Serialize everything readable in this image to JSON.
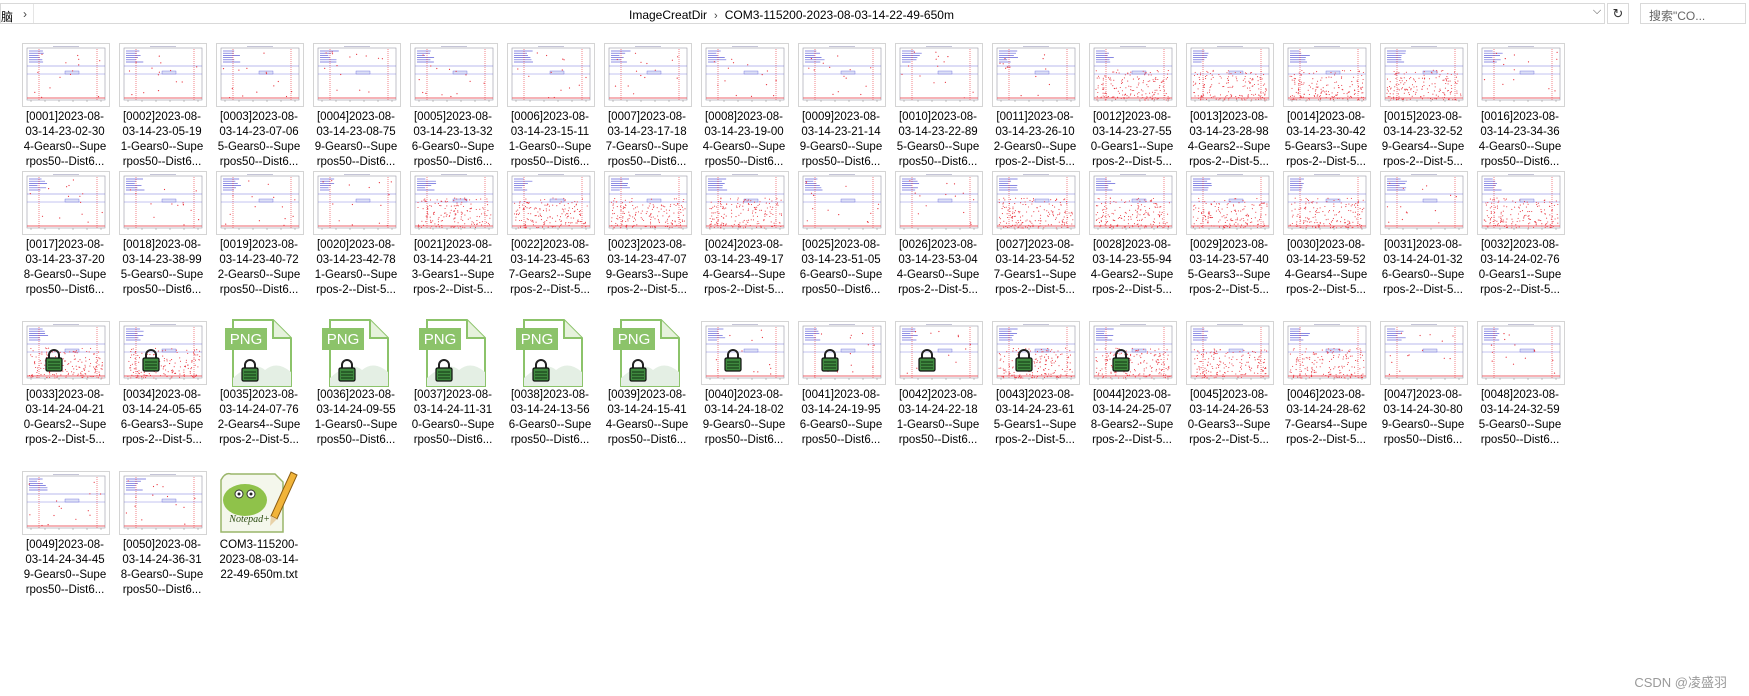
{
  "address_bar": {
    "left_crumb": "脑",
    "path": [
      "ImageCreatDir",
      "COM3-115200-2023-08-03-14-22-49-650m"
    ],
    "dropdown_icon": "chevron-down-icon",
    "refresh_icon": "refresh-icon",
    "search_placeholder": "搜索\"CO..."
  },
  "files": [
    {
      "lines": [
        "[0001]2023-08-",
        "03-14-23-02-30",
        "4-Gears0--Supe",
        "rpos50--Dist6..."
      ],
      "thumb": "flat",
      "locked": false
    },
    {
      "lines": [
        "[0002]2023-08-",
        "03-14-23-05-19",
        "1-Gears0--Supe",
        "rpos50--Dist6..."
      ],
      "thumb": "flat",
      "locked": false
    },
    {
      "lines": [
        "[0003]2023-08-",
        "03-14-23-07-06",
        "5-Gears0--Supe",
        "rpos50--Dist6..."
      ],
      "thumb": "flat",
      "locked": false
    },
    {
      "lines": [
        "[0004]2023-08-",
        "03-14-23-08-75",
        "9-Gears0--Supe",
        "rpos50--Dist6..."
      ],
      "thumb": "flat",
      "locked": false
    },
    {
      "lines": [
        "[0005]2023-08-",
        "03-14-23-13-32",
        "6-Gears0--Supe",
        "rpos50--Dist6..."
      ],
      "thumb": "flat",
      "locked": false
    },
    {
      "lines": [
        "[0006]2023-08-",
        "03-14-23-15-11",
        "1-Gears0--Supe",
        "rpos50--Dist6..."
      ],
      "thumb": "flat",
      "locked": false
    },
    {
      "lines": [
        "[0007]2023-08-",
        "03-14-23-17-18",
        "7-Gears0--Supe",
        "rpos50--Dist6..."
      ],
      "thumb": "flat",
      "locked": false
    },
    {
      "lines": [
        "[0008]2023-08-",
        "03-14-23-19-00",
        "4-Gears0--Supe",
        "rpos50--Dist6..."
      ],
      "thumb": "flat",
      "locked": false
    },
    {
      "lines": [
        "[0009]2023-08-",
        "03-14-23-21-14",
        "9-Gears0--Supe",
        "rpos50--Dist6..."
      ],
      "thumb": "flat",
      "locked": false
    },
    {
      "lines": [
        "[0010]2023-08-",
        "03-14-23-22-89",
        "5-Gears0--Supe",
        "rpos50--Dist6..."
      ],
      "thumb": "flat",
      "locked": false
    },
    {
      "lines": [
        "[0011]2023-08-",
        "03-14-23-26-10",
        "2-Gears0--Supe",
        "rpos-2--Dist-5..."
      ],
      "thumb": "flat",
      "locked": false
    },
    {
      "lines": [
        "[0012]2023-08-",
        "03-14-23-27-55",
        "0-Gears1--Supe",
        "rpos-2--Dist-5..."
      ],
      "thumb": "dense",
      "locked": false
    },
    {
      "lines": [
        "[0013]2023-08-",
        "03-14-23-28-98",
        "4-Gears2--Supe",
        "rpos-2--Dist-5..."
      ],
      "thumb": "dense",
      "locked": false
    },
    {
      "lines": [
        "[0014]2023-08-",
        "03-14-23-30-42",
        "5-Gears3--Supe",
        "rpos-2--Dist-5..."
      ],
      "thumb": "dense",
      "locked": false
    },
    {
      "lines": [
        "[0015]2023-08-",
        "03-14-23-32-52",
        "9-Gears4--Supe",
        "rpos-2--Dist-5..."
      ],
      "thumb": "dense",
      "locked": false
    },
    {
      "lines": [
        "[0016]2023-08-",
        "03-14-23-34-36",
        "4-Gears0--Supe",
        "rpos50--Dist6..."
      ],
      "thumb": "flat",
      "locked": false
    },
    {
      "lines": [
        "[0017]2023-08-",
        "03-14-23-37-20",
        "8-Gears0--Supe",
        "rpos50--Dist6..."
      ],
      "thumb": "flat",
      "locked": false
    },
    {
      "lines": [
        "[0018]2023-08-",
        "03-14-23-38-99",
        "5-Gears0--Supe",
        "rpos50--Dist6..."
      ],
      "thumb": "flat",
      "locked": false
    },
    {
      "lines": [
        "[0019]2023-08-",
        "03-14-23-40-72",
        "2-Gears0--Supe",
        "rpos50--Dist6..."
      ],
      "thumb": "flat",
      "locked": false
    },
    {
      "lines": [
        "[0020]2023-08-",
        "03-14-23-42-78",
        "1-Gears0--Supe",
        "rpos-2--Dist-5..."
      ],
      "thumb": "flat",
      "locked": false
    },
    {
      "lines": [
        "[0021]2023-08-",
        "03-14-23-44-21",
        "3-Gears1--Supe",
        "rpos-2--Dist-5..."
      ],
      "thumb": "dense",
      "locked": false
    },
    {
      "lines": [
        "[0022]2023-08-",
        "03-14-23-45-63",
        "7-Gears2--Supe",
        "rpos-2--Dist-5..."
      ],
      "thumb": "dense",
      "locked": false
    },
    {
      "lines": [
        "[0023]2023-08-",
        "03-14-23-47-07",
        "9-Gears3--Supe",
        "rpos-2--Dist-5..."
      ],
      "thumb": "dense",
      "locked": false
    },
    {
      "lines": [
        "[0024]2023-08-",
        "03-14-23-49-17",
        "4-Gears4--Supe",
        "rpos-2--Dist-5..."
      ],
      "thumb": "dense",
      "locked": false
    },
    {
      "lines": [
        "[0025]2023-08-",
        "03-14-23-51-05",
        "6-Gears0--Supe",
        "rpos50--Dist6..."
      ],
      "thumb": "flat",
      "locked": false
    },
    {
      "lines": [
        "[0026]2023-08-",
        "03-14-23-53-04",
        "4-Gears0--Supe",
        "rpos-2--Dist-5..."
      ],
      "thumb": "flat",
      "locked": false
    },
    {
      "lines": [
        "[0027]2023-08-",
        "03-14-23-54-52",
        "7-Gears1--Supe",
        "rpos-2--Dist-5..."
      ],
      "thumb": "dense",
      "locked": false
    },
    {
      "lines": [
        "[0028]2023-08-",
        "03-14-23-55-94",
        "4-Gears2--Supe",
        "rpos-2--Dist-5..."
      ],
      "thumb": "dense",
      "locked": false
    },
    {
      "lines": [
        "[0029]2023-08-",
        "03-14-23-57-40",
        "5-Gears3--Supe",
        "rpos-2--Dist-5..."
      ],
      "thumb": "dense",
      "locked": false
    },
    {
      "lines": [
        "[0030]2023-08-",
        "03-14-23-59-52",
        "4-Gears4--Supe",
        "rpos-2--Dist-5..."
      ],
      "thumb": "dense",
      "locked": false
    },
    {
      "lines": [
        "[0031]2023-08-",
        "03-14-24-01-32",
        "6-Gears0--Supe",
        "rpos-2--Dist-5..."
      ],
      "thumb": "flat",
      "locked": false
    },
    {
      "lines": [
        "[0032]2023-08-",
        "03-14-24-02-76",
        "0-Gears1--Supe",
        "rpos-2--Dist-5..."
      ],
      "thumb": "dense",
      "locked": false
    },
    {
      "lines": [
        "[0033]2023-08-",
        "03-14-24-04-21",
        "0-Gears2--Supe",
        "rpos-2--Dist-5..."
      ],
      "thumb": "dense",
      "locked": true
    },
    {
      "lines": [
        "[0034]2023-08-",
        "03-14-24-05-65",
        "6-Gears3--Supe",
        "rpos-2--Dist-5..."
      ],
      "thumb": "dense",
      "locked": true
    },
    {
      "lines": [
        "[0035]2023-08-",
        "03-14-24-07-76",
        "2-Gears4--Supe",
        "rpos-2--Dist-5..."
      ],
      "thumb": "png",
      "locked": true
    },
    {
      "lines": [
        "[0036]2023-08-",
        "03-14-24-09-55",
        "1-Gears0--Supe",
        "rpos50--Dist6..."
      ],
      "thumb": "png",
      "locked": true
    },
    {
      "lines": [
        "[0037]2023-08-",
        "03-14-24-11-31",
        "0-Gears0--Supe",
        "rpos50--Dist6..."
      ],
      "thumb": "png",
      "locked": true
    },
    {
      "lines": [
        "[0038]2023-08-",
        "03-14-24-13-56",
        "6-Gears0--Supe",
        "rpos50--Dist6..."
      ],
      "thumb": "png",
      "locked": true
    },
    {
      "lines": [
        "[0039]2023-08-",
        "03-14-24-15-41",
        "4-Gears0--Supe",
        "rpos50--Dist6..."
      ],
      "thumb": "png",
      "locked": true
    },
    {
      "lines": [
        "[0040]2023-08-",
        "03-14-24-18-02",
        "9-Gears0--Supe",
        "rpos50--Dist6..."
      ],
      "thumb": "flat",
      "locked": true
    },
    {
      "lines": [
        "[0041]2023-08-",
        "03-14-24-19-95",
        "6-Gears0--Supe",
        "rpos50--Dist6..."
      ],
      "thumb": "flat",
      "locked": true
    },
    {
      "lines": [
        "[0042]2023-08-",
        "03-14-24-22-18",
        "1-Gears0--Supe",
        "rpos50--Dist6..."
      ],
      "thumb": "flat",
      "locked": true
    },
    {
      "lines": [
        "[0043]2023-08-",
        "03-14-24-23-61",
        "5-Gears1--Supe",
        "rpos-2--Dist-5..."
      ],
      "thumb": "dense",
      "locked": true
    },
    {
      "lines": [
        "[0044]2023-08-",
        "03-14-24-25-07",
        "8-Gears2--Supe",
        "rpos-2--Dist-5..."
      ],
      "thumb": "dense",
      "locked": true
    },
    {
      "lines": [
        "[0045]2023-08-",
        "03-14-24-26-53",
        "0-Gears3--Supe",
        "rpos-2--Dist-5..."
      ],
      "thumb": "dense",
      "locked": false
    },
    {
      "lines": [
        "[0046]2023-08-",
        "03-14-24-28-62",
        "7-Gears4--Supe",
        "rpos-2--Dist-5..."
      ],
      "thumb": "dense",
      "locked": false
    },
    {
      "lines": [
        "[0047]2023-08-",
        "03-14-24-30-80",
        "9-Gears0--Supe",
        "rpos50--Dist6..."
      ],
      "thumb": "flat",
      "locked": false
    },
    {
      "lines": [
        "[0048]2023-08-",
        "03-14-24-32-59",
        "5-Gears0--Supe",
        "rpos50--Dist6..."
      ],
      "thumb": "flat",
      "locked": false
    },
    {
      "lines": [
        "[0049]2023-08-",
        "03-14-24-34-45",
        "9-Gears0--Supe",
        "rpos50--Dist6..."
      ],
      "thumb": "flat",
      "locked": false
    },
    {
      "lines": [
        "[0050]2023-08-",
        "03-14-24-36-31",
        "8-Gears0--Supe",
        "rpos50--Dist6..."
      ],
      "thumb": "flat",
      "locked": false
    },
    {
      "lines": [
        "COM3-115200-",
        "2023-08-03-14-",
        "22-49-650m.txt"
      ],
      "thumb": "notepad",
      "locked": false
    }
  ],
  "png_badge_text": "PNG",
  "notepad_icon_text": "Notepad++",
  "watermark": "CSDN @凌盛羽",
  "colors": {
    "chart_red": "#e8323c",
    "chart_blue": "#3a3ad0",
    "png_green": "#8cc36a",
    "lock_green": "#3f8a3f"
  }
}
